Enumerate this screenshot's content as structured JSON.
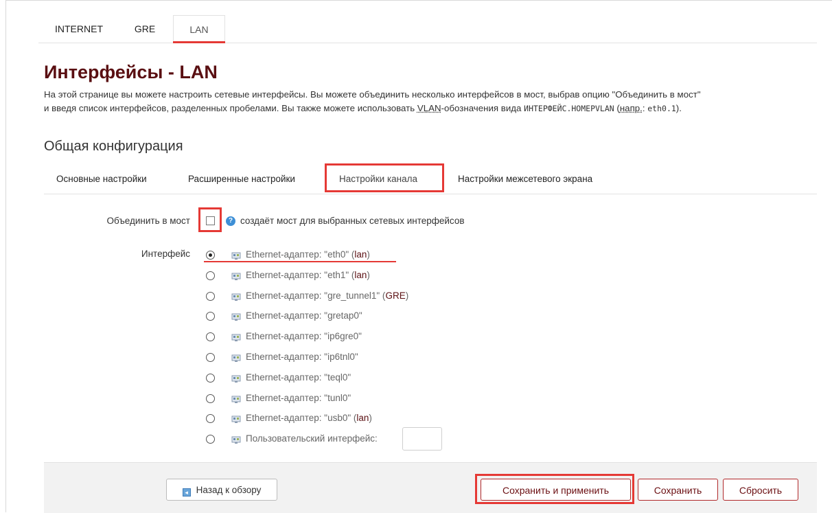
{
  "top_tabs": [
    "INTERNET",
    "GRE",
    "LAN"
  ],
  "active_top_tab": "LAN",
  "page_title": "Интерфейсы - LAN",
  "description": {
    "line1": "На этой странице вы можете настроить сетевые интерфейсы. Вы можете объединить несколько интерфейсов в мост, выбрав опцию \"Объединить в мост\"",
    "line2_a": "и введя список интерфейсов, разделенных пробелами. Вы также можете использовать ",
    "line2_abbr1": "VLAN",
    "line2_b": "-обозначения вида ",
    "line2_code1": "ИНТЕРФЕЙС.НОМЕРVLAN",
    "line2_c": " (",
    "line2_abbr2": "напр.",
    "line2_d": ": ",
    "line2_code2": "eth0.1",
    "line2_e": ")."
  },
  "section_title": "Общая конфигурация",
  "sub_tabs": [
    "Основные настройки",
    "Расширенные настройки",
    "Настройки канала",
    "Настройки межсетевого экрана"
  ],
  "active_sub_tab": "Настройки канала",
  "bridge": {
    "label": "Объединить в мост",
    "checked": false,
    "help_icon": "help-icon",
    "help_text": "создаёт мост для выбранных сетевых интерфейсов"
  },
  "interface": {
    "label": "Интерфейс",
    "options": [
      {
        "text": "Ethernet-адаптер: \"eth0\" (",
        "zone": "lan",
        "end": ")",
        "checked": true
      },
      {
        "text": "Ethernet-адаптер: \"eth1\" (",
        "zone": "lan",
        "end": ")",
        "checked": false
      },
      {
        "text": "Ethernet-адаптер: \"gre_tunnel1\" (",
        "zone": "GRE",
        "end": ")",
        "checked": false
      },
      {
        "text": "Ethernet-адаптер: \"gretap0\"",
        "zone": "",
        "end": "",
        "checked": false
      },
      {
        "text": "Ethernet-адаптер: \"ip6gre0\"",
        "zone": "",
        "end": "",
        "checked": false
      },
      {
        "text": "Ethernet-адаптер: \"ip6tnl0\"",
        "zone": "",
        "end": "",
        "checked": false
      },
      {
        "text": "Ethernet-адаптер: \"teql0\"",
        "zone": "",
        "end": "",
        "checked": false
      },
      {
        "text": "Ethernet-адаптер: \"tunl0\"",
        "zone": "",
        "end": "",
        "checked": false
      },
      {
        "text": "Ethernet-адаптер: \"usb0\" (",
        "zone": "lan",
        "end": ")",
        "checked": false
      },
      {
        "text": "Пользовательский интерфейс:",
        "zone": "",
        "end": "",
        "checked": false
      }
    ],
    "custom_value": ""
  },
  "footer": {
    "back_label": "Назад к обзору",
    "save_apply_label": "Сохранить и применить",
    "save_label": "Сохранить",
    "reset_label": "Сбросить"
  },
  "colors": {
    "accent_red": "#e53935",
    "title_dark_red": "#5a0f12"
  }
}
